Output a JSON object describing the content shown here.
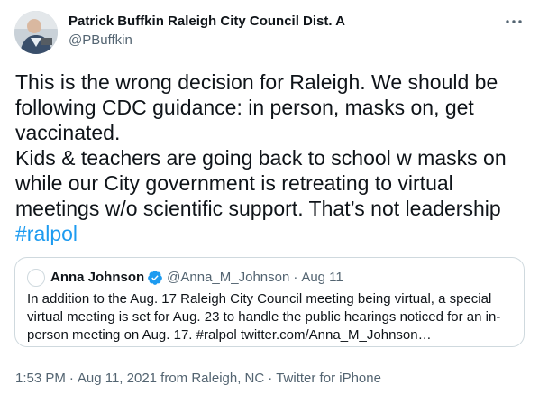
{
  "author": {
    "name": "Patrick Buffkin Raleigh City Council Dist. A",
    "handle": "@PBuffkin"
  },
  "tweet": {
    "lines": [
      "This is the wrong decision for Raleigh. We should be",
      "following CDC guidance: in person, masks on, get",
      "vaccinated.",
      "Kids & teachers are going back to school w masks on",
      "while our City government is retreating to virtual",
      "meetings w/o scientific support. That’s not leadership"
    ],
    "hashtag": "#ralpol"
  },
  "quote": {
    "name": "Anna Johnson",
    "verified_icon": "verified-badge-icon",
    "handle": "@Anna_M_Johnson",
    "separator": "·",
    "date": "Aug 11",
    "lines": [
      "In addition to the Aug. 17 Raleigh City Council meeting being virtual, a special",
      "virtual meeting is set for Aug. 23 to handle the public hearings noticed for an in-",
      "person meeting on Aug. 17. #ralpol twitter.com/Anna_M_Johnson…"
    ]
  },
  "meta": {
    "time": "1:53 PM",
    "separator": "·",
    "date": "Aug 11, 2021 from Raleigh, NC",
    "source": "Twitter for iPhone"
  },
  "colors": {
    "text": "#0f1419",
    "secondary": "#536471",
    "accent": "#1d9bf0",
    "border": "#cfd9de"
  },
  "icons": {
    "more": "more-dots-icon",
    "verified": "verified-badge-icon"
  }
}
